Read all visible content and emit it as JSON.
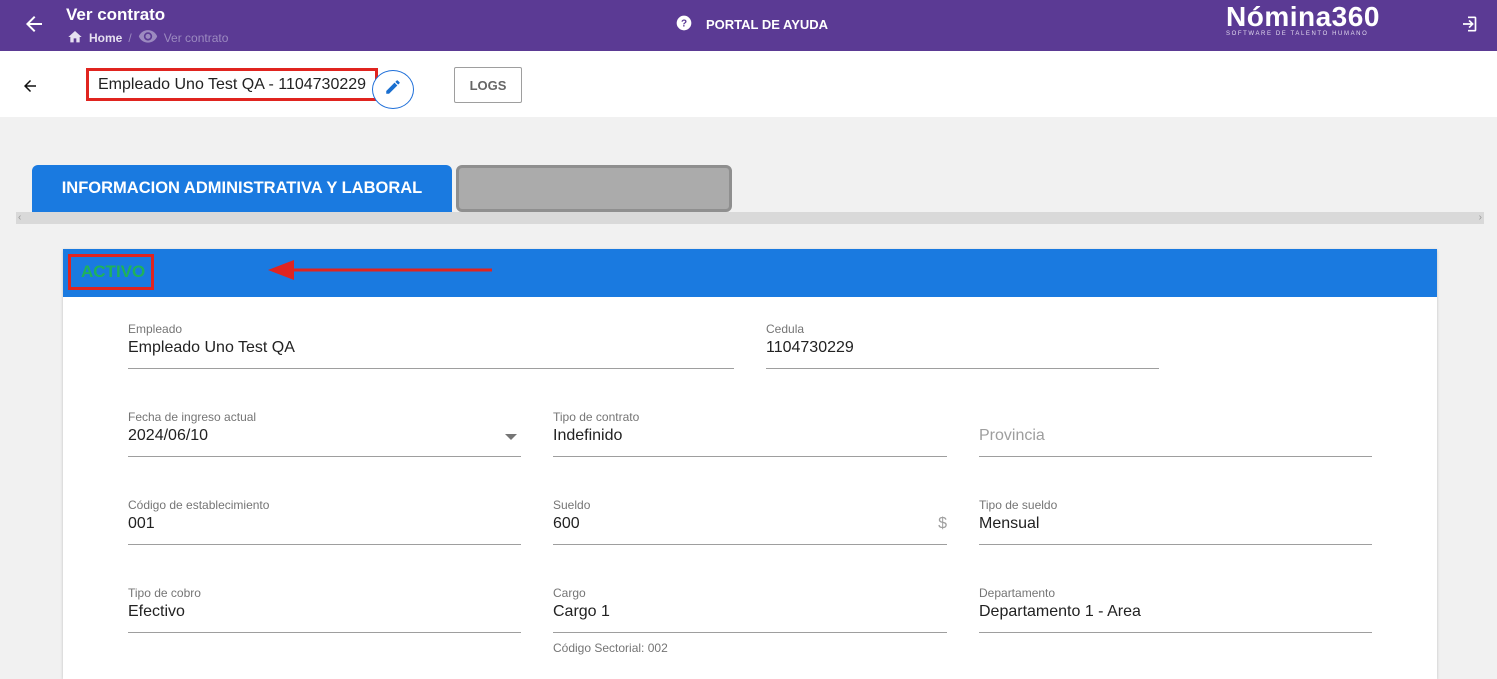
{
  "topbar": {
    "title": "Ver contrato",
    "breadcrumb": {
      "home": "Home",
      "sep": "/",
      "current": "Ver contrato"
    },
    "help_label": "PORTAL DE AYUDA",
    "logo_main": "Nómina360",
    "logo_sub": "SOFTWARE DE TALENTO HUMANO"
  },
  "header": {
    "employee_title": "Empleado Uno Test QA - 1104730229",
    "logs_label": "LOGS"
  },
  "tabs": [
    {
      "label": "INFORMACION ADMINISTRATIVA Y LABORAL",
      "active": true
    },
    {
      "label": "",
      "active": false
    }
  ],
  "card": {
    "status": "ACTIVO",
    "status_color": "#1fb25a",
    "fields": {
      "empleado": {
        "label": "Empleado",
        "value": "Empleado Uno Test QA"
      },
      "cedula": {
        "label": "Cedula",
        "value": "1104730229"
      },
      "fecha_ingreso": {
        "label": "Fecha de ingreso actual",
        "value": "2024/06/10"
      },
      "tipo_contrato": {
        "label": "Tipo de contrato",
        "value": "Indefinido"
      },
      "provincia": {
        "placeholder": "Provincia"
      },
      "codigo_establecimiento": {
        "label": "Código de establecimiento",
        "value": "001"
      },
      "sueldo": {
        "label": "Sueldo",
        "value": "600",
        "suffix": "$"
      },
      "tipo_sueldo": {
        "label": "Tipo de sueldo",
        "value": "Mensual"
      },
      "tipo_cobro": {
        "label": "Tipo de cobro",
        "value": "Efectivo"
      },
      "cargo": {
        "label": "Cargo",
        "value": "Cargo 1",
        "hint": "Código Sectorial: 002"
      },
      "departamento": {
        "label": "Departamento",
        "value": "Departamento 1 - Area"
      }
    }
  },
  "colors": {
    "topbar": "#5b3a94",
    "accent": "#1a7ae0",
    "highlight": "#e0241f"
  }
}
